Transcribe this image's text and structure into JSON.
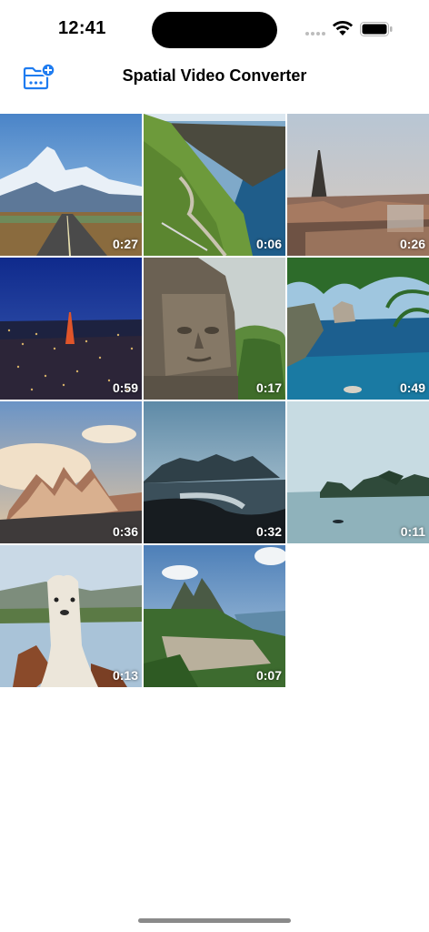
{
  "status_bar": {
    "time": "12:41"
  },
  "nav": {
    "title": "Spatial Video Converter",
    "import_icon": "folder-badge-plus-icon",
    "accent_color": "#1f7cf0"
  },
  "videos": [
    {
      "duration": "0:27",
      "subject": "mountain-road"
    },
    {
      "duration": "0:06",
      "subject": "coastal-cliffs"
    },
    {
      "duration": "0:26",
      "subject": "paris-eiffel-tower"
    },
    {
      "duration": "0:59",
      "subject": "tokyo-night"
    },
    {
      "duration": "0:17",
      "subject": "stone-face-temple"
    },
    {
      "duration": "0:49",
      "subject": "tropical-sea-palms"
    },
    {
      "duration": "0:36",
      "subject": "mountain-peaks-sunset"
    },
    {
      "duration": "0:32",
      "subject": "beach-mountains"
    },
    {
      "duration": "0:11",
      "subject": "bay-islands"
    },
    {
      "duration": "0:13",
      "subject": "alpaca-lake"
    },
    {
      "duration": "0:07",
      "subject": "island-peaks-town"
    }
  ]
}
